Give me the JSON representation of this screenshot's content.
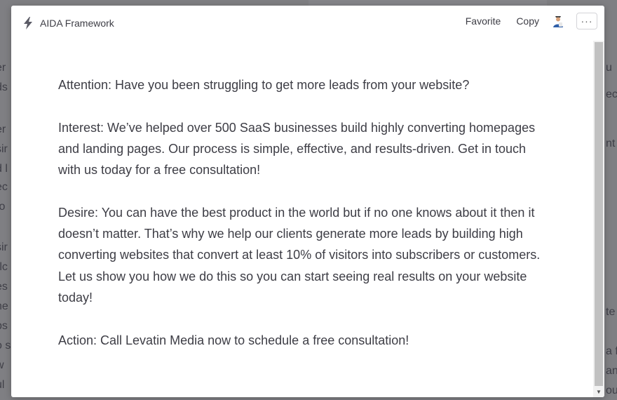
{
  "modal": {
    "title": "AIDA Framework",
    "actions": {
      "favorite": "Favorite",
      "copy": "Copy",
      "more": "···"
    },
    "paragraphs": [
      "Attention: Have you been struggling to get more leads from your website?",
      "Interest: We’ve helped over 500 SaaS businesses build highly converting homepages and landing pages. Our process is simple, effective, and results-driven. Get in touch with us today for a free consultation!",
      "Desire: You can have the best product in the world but if no one knows about it then it doesn’t matter. That’s why we help our clients generate more leads by building high converting websites that convert at least 10% of visitors into subscribers or customers. Let us show you how we do this so you can start seeing real results on your website today!",
      "Action: Call Levatin Media now to schedule a free consultation!"
    ]
  },
  "colors": {
    "accent_icon": "#5b5b66",
    "text": "#3d3d45",
    "backdrop": "#7f7f83"
  },
  "icons": {
    "title_icon": "lightning-bolt-icon",
    "avatar": "user-avatar-icon",
    "scroll_down": "scroll-down-arrow-icon"
  }
}
